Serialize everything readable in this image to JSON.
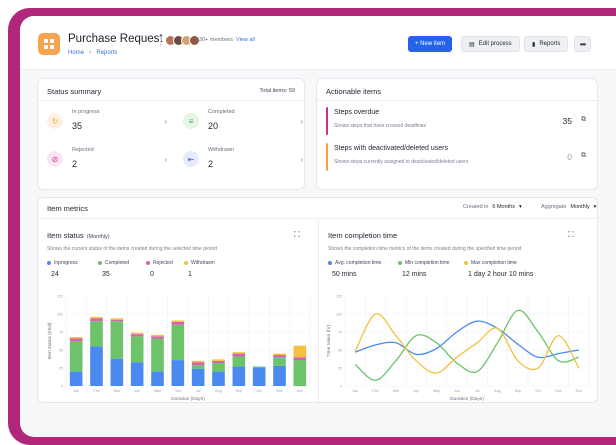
{
  "header": {
    "title": "Purchase Request",
    "breadcrumb": [
      "Home",
      "Reports"
    ],
    "members_text": "130+ members",
    "view_all": "View all",
    "buttons": {
      "new_item": "+ New item",
      "edit_process": "Edit process",
      "reports": "Reports",
      "more": "•••"
    }
  },
  "status_summary": {
    "title": "Status summary",
    "total_label": "Total items: 59",
    "items": [
      {
        "label": "In progress",
        "value": "35",
        "icon": "spinner-icon",
        "color": "#f0a63c",
        "bg": "#fdf1e2"
      },
      {
        "label": "Completed",
        "value": "20",
        "icon": "check-list-icon",
        "color": "#3aa758",
        "bg": "#e5f5e8"
      },
      {
        "label": "Rejected",
        "value": "2",
        "icon": "ban-icon",
        "color": "#c6329a",
        "bg": "#fae6f3"
      },
      {
        "label": "Withdrawn",
        "value": "2",
        "icon": "withdraw-icon",
        "color": "#4a5bd8",
        "bg": "#e8ebfb"
      }
    ]
  },
  "actionable": {
    "title": "Actionable items",
    "items": [
      {
        "title": "Steps overdue",
        "subtitle": "Shows steps that have crossed deadlines",
        "count": "35",
        "bar_color": "#c6329a"
      },
      {
        "title": "Steps with deactivated/deleted users",
        "subtitle": "Shows steps currently assigned to deactivated/deleted users",
        "count": "0",
        "bar_color": "#f0a63c"
      }
    ]
  },
  "metrics": {
    "title": "Item metrics",
    "created_label": "Created in",
    "created_value": "6 Months",
    "aggregate_label": "Aggregate",
    "aggregate_value": "Monthly",
    "item_status": {
      "title": "Item status",
      "subtitle": "(Monthly)",
      "desc": "Shows the current status of the items created during the selected time period",
      "legend": [
        {
          "label": "Inprogress",
          "value": "24",
          "color": "#4a8af0"
        },
        {
          "label": "Completed",
          "value": "35",
          "color": "#6cc36a"
        },
        {
          "label": "Rejected",
          "value": "0",
          "color": "#d75fb4"
        },
        {
          "label": "Withdrawn",
          "value": "1",
          "color": "#f4c03e"
        }
      ]
    },
    "completion_time": {
      "title": "Item completion time",
      "desc": "Shows the completion time metrics of the items created during the specified time period",
      "legend": [
        {
          "label": "Avg. completion time",
          "value": "50 mins",
          "color": "#4a8af0"
        },
        {
          "label": "Min completion time",
          "value": "12 mins",
          "color": "#6cc36a"
        },
        {
          "label": "Max completion time",
          "value": "1 day 2 hour 10 mins",
          "color": "#f4c03e"
        }
      ]
    }
  },
  "chart_data": [
    {
      "type": "bar",
      "stacked": true,
      "xlabel": "Duration (Days)",
      "ylabel": "Item status (total)",
      "ylim": [
        0,
        125
      ],
      "categories": [
        "Jan",
        "Feb",
        "Mar",
        "Apr",
        "May",
        "Jun",
        "Jul",
        "Aug",
        "Sep",
        "Oct",
        "Nov",
        "Dec"
      ],
      "series": [
        {
          "name": "Inprogress",
          "color": "#4a8af0",
          "values": [
            20,
            55,
            38,
            33,
            20,
            36,
            24,
            20,
            27,
            26,
            28,
            0
          ]
        },
        {
          "name": "Completed",
          "color": "#6cc36a",
          "values": [
            42,
            35,
            52,
            36,
            46,
            49,
            5,
            12,
            14,
            1,
            12,
            36
          ]
        },
        {
          "name": "Rejected",
          "color": "#d75fb4",
          "values": [
            4,
            4,
            2,
            3,
            3,
            4,
            4,
            3,
            4,
            0,
            3,
            4
          ]
        },
        {
          "name": "Withdrawn",
          "color": "#f4c03e",
          "values": [
            2,
            2,
            2,
            2,
            2,
            2,
            2,
            2,
            2,
            0,
            2,
            16
          ]
        }
      ]
    },
    {
      "type": "line",
      "xlabel": "Duration (Days)",
      "ylabel": "Time taken (hr)",
      "ylim": [
        0,
        125
      ],
      "categories": [
        "Jan",
        "Feb",
        "Mar",
        "Apr",
        "May",
        "Jun",
        "Jul",
        "Aug",
        "Sep",
        "Oct",
        "Nov",
        "Dec"
      ],
      "series": [
        {
          "name": "Avg. completion time",
          "color": "#4a8af0",
          "values": [
            47,
            57,
            60,
            44,
            52,
            75,
            90,
            80,
            58,
            40,
            45,
            50
          ]
        },
        {
          "name": "Min completion time",
          "color": "#6cc36a",
          "values": [
            30,
            8,
            35,
            70,
            60,
            32,
            20,
            60,
            105,
            75,
            35,
            40
          ]
        },
        {
          "name": "Max completion time",
          "color": "#f4c03e",
          "values": [
            48,
            100,
            70,
            35,
            18,
            40,
            60,
            80,
            35,
            25,
            70,
            25
          ]
        }
      ]
    }
  ]
}
